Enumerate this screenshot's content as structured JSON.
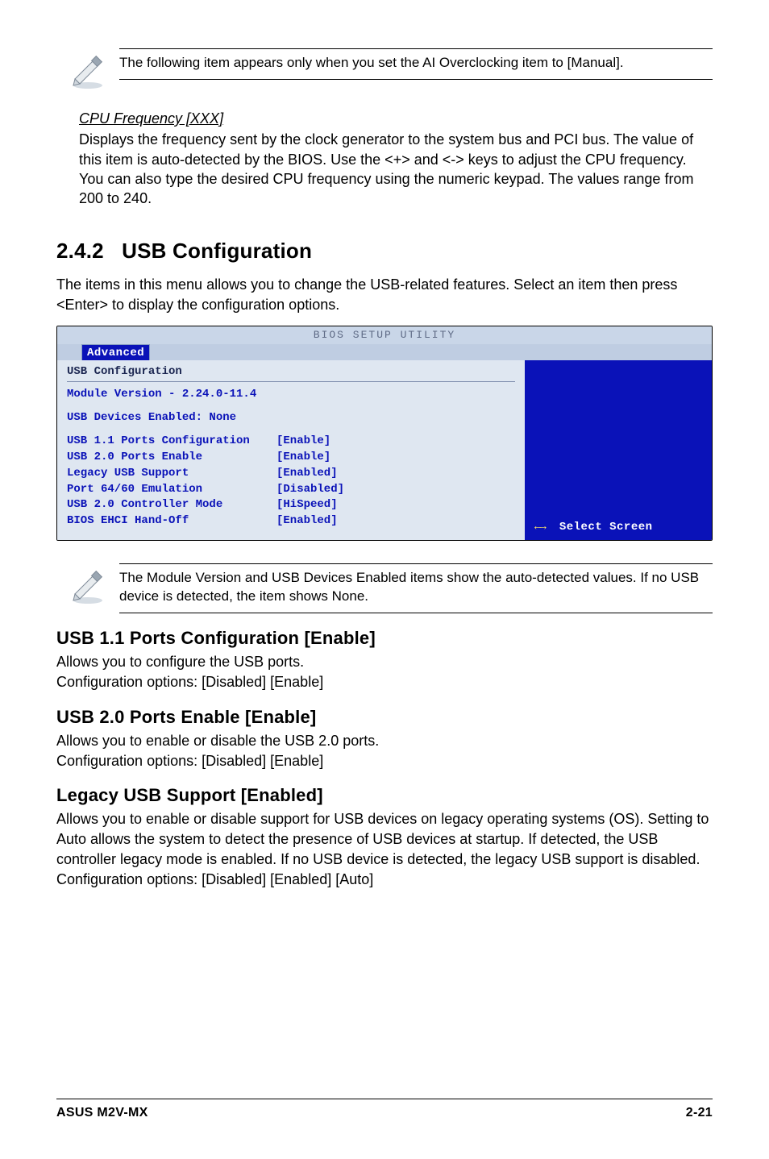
{
  "notes": {
    "top": "The following item appears only when you set the AI Overclocking item to [Manual].",
    "module": "The Module Version and USB Devices Enabled items show the auto-detected values. If no USB device is detected, the item shows None."
  },
  "cpu": {
    "heading": "CPU Frequency [XXX]",
    "body": "Displays the frequency sent by the clock generator to the system bus and PCI bus. The value of this item is auto-detected by the BIOS. Use the <+> and <-> keys to adjust the CPU frequency. You can also type the desired CPU frequency using the numeric keypad. The values range from 200 to 240."
  },
  "section": {
    "number": "2.4.2",
    "title": "USB Configuration",
    "intro": "The items in this menu allows you to change the USB-related features. Select an item then press <Enter> to display the configuration options."
  },
  "bios": {
    "titlebar": "BIOS SETUP UTILITY",
    "tab": "Advanced",
    "panel_title": "USB Configuration",
    "module_line": "Module Version - 2.24.0-11.4",
    "devices_line": "USB Devices Enabled: None",
    "rows": [
      {
        "label": "USB 1.1 Ports Configuration",
        "value": "[Enable]"
      },
      {
        "label": "USB 2.0 Ports Enable",
        "value": "[Enable]"
      },
      {
        "label": "Legacy USB Support",
        "value": "[Enabled]"
      },
      {
        "label": "Port 64/60 Emulation",
        "value": "[Disabled]"
      },
      {
        "label": "USB 2.0 Controller Mode",
        "value": "[HiSpeed]"
      },
      {
        "label": "BIOS EHCI Hand-Off",
        "value": "[Enabled]"
      }
    ],
    "help_arrows": "←→",
    "help_text": "Select Screen"
  },
  "settings": {
    "usb11": {
      "title": "USB 1.1 Ports Configuration [Enable]",
      "body1": "Allows you to configure the USB ports.",
      "body2": "Configuration options: [Disabled] [Enable]"
    },
    "usb20": {
      "title": "USB 2.0 Ports Enable [Enable]",
      "body1": "Allows you to enable or disable the USB 2.0 ports.",
      "body2": "Configuration options: [Disabled] [Enable]"
    },
    "legacy": {
      "title": "Legacy USB Support [Enabled]",
      "body": "Allows you to enable or disable support for USB devices on legacy operating systems (OS). Setting to Auto allows the system to detect the presence of USB devices at startup. If detected, the USB controller legacy mode is enabled. If no USB device is detected, the legacy USB support is disabled. Configuration options: [Disabled] [Enabled] [Auto]"
    }
  },
  "footer": {
    "left": "ASUS M2V-MX",
    "right": "2-21"
  }
}
